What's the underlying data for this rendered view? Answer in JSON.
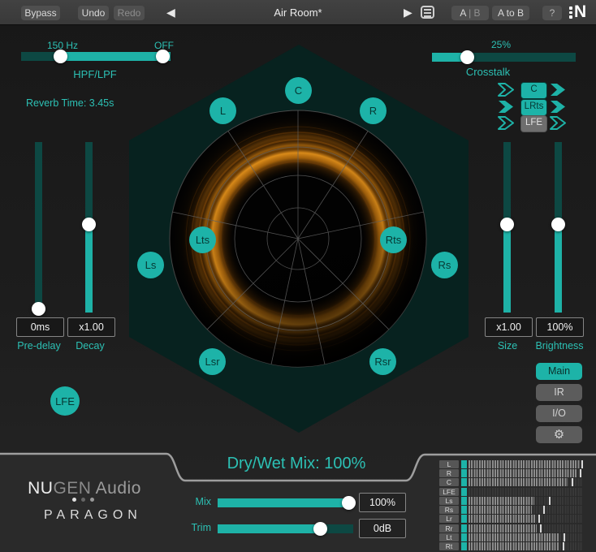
{
  "titlebar": {
    "bypass": "Bypass",
    "undo": "Undo",
    "redo": "Redo",
    "preset": "Air Room*",
    "ab_primary": "A",
    "ab_secondary": " | B",
    "a_to_b": "A to B",
    "help": "?",
    "brand": "N"
  },
  "filters": {
    "hpf_value": "150 Hz",
    "lpf_value": "OFF",
    "label": "HPF/LPF"
  },
  "reverb_time": "Reverb Time: 3.45s",
  "crosstalk": {
    "value": "25%",
    "label": "Crosstalk",
    "rows": [
      {
        "label": "C",
        "state": "on",
        "left_arrow": "outline",
        "right_arrow": "filled"
      },
      {
        "label": "LRts",
        "state": "on",
        "left_arrow": "filled",
        "right_arrow": "filled"
      },
      {
        "label": "LFE",
        "state": "off",
        "left_arrow": "outline",
        "right_arrow": "outline"
      }
    ]
  },
  "sliders": {
    "pre_delay": {
      "label": "Pre-delay",
      "value": "0ms"
    },
    "decay": {
      "label": "Decay",
      "value": "x1.00"
    },
    "size": {
      "label": "Size",
      "value": "x1.00"
    },
    "brightness": {
      "label": "Brightness",
      "value": "100%"
    }
  },
  "channels": {
    "c": "C",
    "l": "L",
    "r": "R",
    "lts": "Lts",
    "rts": "Rts",
    "ls": "Ls",
    "rs": "Rs",
    "lsr": "Lsr",
    "rsr": "Rsr",
    "lfe": "LFE"
  },
  "nav": {
    "main": "Main",
    "ir": "IR",
    "io": "I/O",
    "settings_icon": "gear-icon"
  },
  "footer": {
    "brand_nu": "NU",
    "brand_gen": "GEN",
    "brand_audio": " Audio",
    "product": "PARAGON",
    "drywet": "Dry/Wet Mix: 100%",
    "mix_label": "Mix",
    "mix_value": "100%",
    "trim_label": "Trim",
    "trim_value": "0dB"
  },
  "meter": {
    "rows": [
      {
        "label": "L",
        "level": "98%",
        "peak": "99%"
      },
      {
        "label": "R",
        "level": "96%",
        "peak": "97.5%"
      },
      {
        "label": "C",
        "level": "87%",
        "peak": "91%"
      },
      {
        "label": "LFE",
        "level": "0%",
        "peak": ""
      },
      {
        "label": "Ls",
        "level": "58%",
        "peak": "71%"
      },
      {
        "label": "Rs",
        "level": "56%",
        "peak": "66%"
      },
      {
        "label": "Lr",
        "level": "59%",
        "peak": "61.5%"
      },
      {
        "label": "Rr",
        "level": "60%",
        "peak": "62.5%"
      },
      {
        "label": "Lt",
        "level": "80%",
        "peak": "83.5%"
      },
      {
        "label": "Rt",
        "level": "80%",
        "peak": "83%"
      }
    ]
  },
  "colors": {
    "accent": "#1eb2a7",
    "accent_text": "#2cc0b4",
    "track_dark": "#0d4843",
    "hexagon": "#07221f",
    "orange": "#e8860f"
  }
}
